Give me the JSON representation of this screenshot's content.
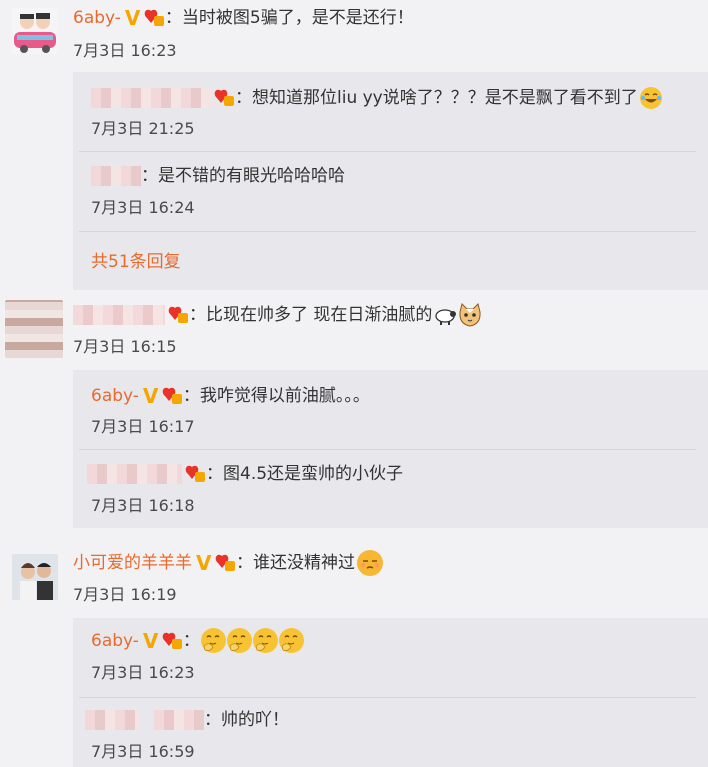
{
  "comments": [
    {
      "username": "6aby-",
      "text": "：当时被图5骗了，是不是还行！",
      "time": "7月3日 16:23",
      "replies": [
        {
          "username": "",
          "text": "：想知道那位liu yy说啥了？？？是不是飘了看不到了",
          "time": "7月3日 21:25"
        },
        {
          "username": "",
          "text": "：是不错的有眼光哈哈哈哈",
          "time": "7月3日 16:24"
        }
      ],
      "more_label": "共51条回复"
    },
    {
      "username": "",
      "text": "：比现在帅多了 现在日渐油腻的",
      "time": "7月3日 16:15",
      "replies": [
        {
          "username": "6aby-",
          "text": "：我咋觉得以前油腻。。。",
          "time": "7月3日 16:17"
        },
        {
          "username": "",
          "text": "：图4.5还是蛮帅的小伙子",
          "time": "7月3日 16:18"
        }
      ]
    },
    {
      "username": "小可爱的羊羊羊",
      "text": "：谁还没精神过",
      "time": "7月3日 16:19",
      "replies": [
        {
          "username": "6aby-",
          "text": "：",
          "time": "7月3日 16:23"
        },
        {
          "username": "",
          "text": "：帅的吖！",
          "time": "7月3日 16:59"
        }
      ]
    }
  ],
  "colors": {
    "username": "#e86a2e",
    "background": "#f2f2f5",
    "reply_bg": "#e8e8ec",
    "vip_badge": "#f5a600"
  },
  "icons": [
    "verified-v-icon",
    "fan-badge-icon",
    "laugh-cry-emoji-icon",
    "sheep-icon",
    "cat-icon",
    "sleepy-emoji-icon",
    "thinking-emoji-icon"
  ]
}
